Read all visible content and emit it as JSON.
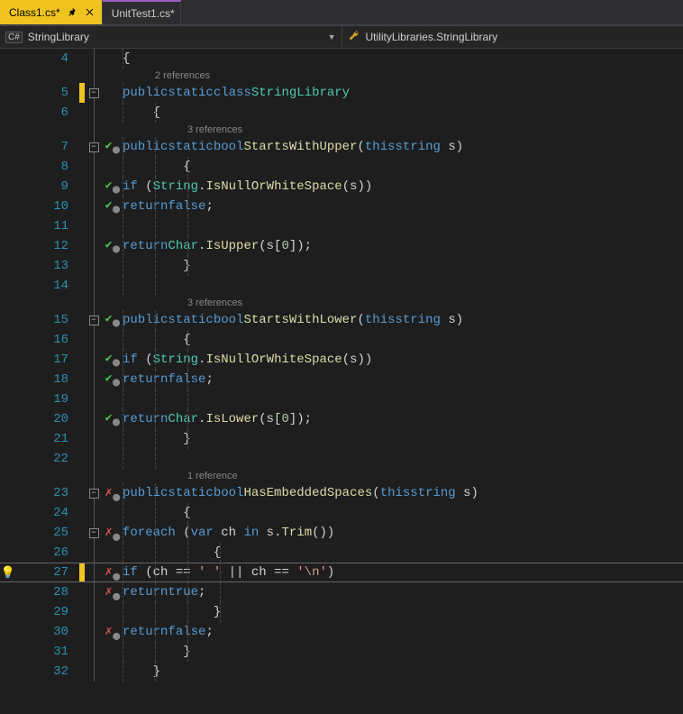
{
  "tabs": [
    {
      "label": "Class1.cs*",
      "active": true,
      "pinned": true
    },
    {
      "label": "UnitTest1.cs*",
      "active": false,
      "pinned": false
    }
  ],
  "nav": {
    "leftBadge": "C#",
    "left": "StringLibrary",
    "right": "UtilityLibraries.StringLibrary"
  },
  "codelens": {
    "class": "2 references",
    "m1": "3 references",
    "m2": "3 references",
    "m3": "1 reference"
  },
  "code": {
    "l5_public": "public",
    "l5_static": "static",
    "l5_class": "class",
    "l5_name": "StringLibrary",
    "l7_sig1": "public",
    "l7_sig2": "static",
    "l7_sig3": "bool",
    "l7_method": "StartsWithUpper",
    "l7_sig4": "this",
    "l7_sig5": "string",
    "l7_param": "s",
    "l9_if": "if",
    "l9_type": "String",
    "l9_m": "IsNullOrWhiteSpace",
    "l9_arg": "s",
    "l10_ret": "return",
    "l10_val": "false",
    "l12_ret": "return",
    "l12_type": "Char",
    "l12_m": "IsUpper",
    "l12_arg": "s",
    "l12_idx": "0",
    "l15_method": "StartsWithLower",
    "l20_m": "IsLower",
    "l23_method": "HasEmbeddedSpaces",
    "l25_foreach": "foreach",
    "l25_var": "var",
    "l25_ch": "ch",
    "l25_in": "in",
    "l25_s": "s",
    "l25_trim": "Trim",
    "l27_if": "if",
    "l27_ch": "ch",
    "l27_sp": "' '",
    "l27_nl": "'\\n'",
    "l28_ret": "return",
    "l28_true": "true",
    "l30_ret": "return",
    "l30_false": "false"
  },
  "lineNumbers": [
    "4",
    "5",
    "6",
    "7",
    "8",
    "9",
    "10",
    "11",
    "12",
    "13",
    "14",
    "15",
    "16",
    "17",
    "18",
    "19",
    "20",
    "21",
    "22",
    "23",
    "24",
    "25",
    "26",
    "27",
    "28",
    "29",
    "30",
    "31",
    "32"
  ],
  "testStatus": {
    "7": "pass",
    "9": "pass",
    "10": "pass",
    "12": "pass",
    "15": "pass",
    "17": "pass",
    "18": "pass",
    "20": "pass",
    "23": "fail",
    "25": "fail",
    "27": "fail",
    "28": "fail",
    "30": "fail"
  },
  "changed": [
    "5",
    "27"
  ],
  "folds": [
    "5",
    "7",
    "15",
    "23",
    "25"
  ],
  "highlightLine": "27"
}
